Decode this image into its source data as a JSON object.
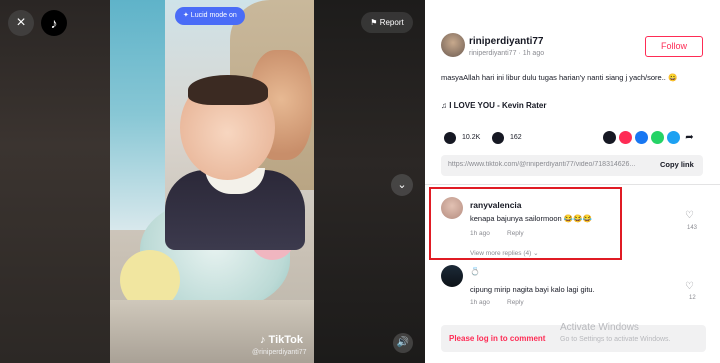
{
  "video": {
    "close_icon": "×",
    "tiktok_logo": "♪",
    "lucid_label": "✦ Lucid mode on",
    "report_label": "⚑ Report",
    "chevron_icon": "⌄",
    "watermark_brand": "♪ TikTok",
    "watermark_user": "@riniperdiyanti77",
    "sound_icon": "🔊"
  },
  "post": {
    "username": "riniperdiyanti77",
    "subline": "riniperdiyanti77 · 1h ago",
    "follow_label": "Follow",
    "caption": "masyaAllah hari ini libur dulu tugas harian'y nanti siang j yach/sore.. 😀",
    "music": "♫ I LOVE YOU - Kevin Rater",
    "likes": "10.2K",
    "comments_count": "162",
    "url": "https://www.tiktok.com/@riniperdiyanti77/video/718314626...",
    "copy_label": "Copy link"
  },
  "comments": [
    {
      "name": "ranyvalencia",
      "text": "kenapa bajunya sailormoon 😂😂😂",
      "time": "1h ago",
      "reply": "Reply",
      "more": "View more replies (4) ⌄",
      "likes": "143"
    },
    {
      "badge": "💍",
      "text": "cipung mirip nagita bayi kalo lagi gitu.",
      "time": "1h ago",
      "reply": "Reply",
      "likes": "12"
    }
  ],
  "footer": {
    "login_label": "Please log in to comment",
    "activate_title": "Activate Windows",
    "activate_sub": "Go to Settings to activate Windows."
  },
  "colors": {
    "accent": "#fe2c55",
    "highlight": "#e01b24",
    "lucid": "#4a6cf7"
  }
}
